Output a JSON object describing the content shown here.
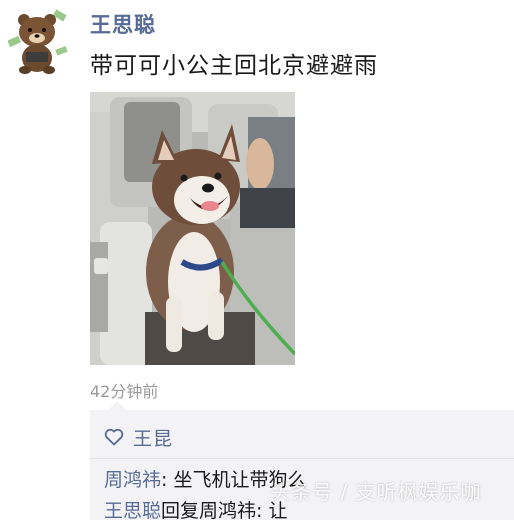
{
  "post": {
    "username": "王思聪",
    "text": "带可可小公主回北京避避雨",
    "timestamp": "42分钟前"
  },
  "likes": {
    "icon": "heart-icon",
    "names": "王昆"
  },
  "comments": [
    {
      "author": "周鸿祎",
      "separator": ": ",
      "text": "坐飞机让带狗么"
    },
    {
      "author": "王思聪",
      "separator": "",
      "text": "回复周鸿祎: 让"
    }
  ],
  "watermark": "头条号 / 支听枫娱乐咖",
  "colors": {
    "link_blue": "#576b95",
    "panel_bg": "#f3f3f5",
    "timestamp_gray": "#9a9a9a"
  }
}
